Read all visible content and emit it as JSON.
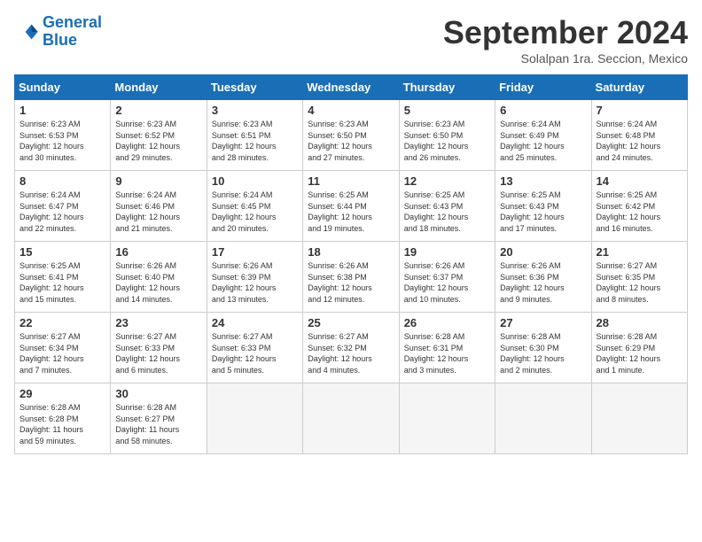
{
  "header": {
    "logo_line1": "General",
    "logo_line2": "Blue",
    "month": "September 2024",
    "location": "Solalpan 1ra. Seccion, Mexico"
  },
  "days_of_week": [
    "Sunday",
    "Monday",
    "Tuesday",
    "Wednesday",
    "Thursday",
    "Friday",
    "Saturday"
  ],
  "weeks": [
    [
      {
        "num": "1",
        "detail": "Sunrise: 6:23 AM\nSunset: 6:53 PM\nDaylight: 12 hours\nand 30 minutes."
      },
      {
        "num": "2",
        "detail": "Sunrise: 6:23 AM\nSunset: 6:52 PM\nDaylight: 12 hours\nand 29 minutes."
      },
      {
        "num": "3",
        "detail": "Sunrise: 6:23 AM\nSunset: 6:51 PM\nDaylight: 12 hours\nand 28 minutes."
      },
      {
        "num": "4",
        "detail": "Sunrise: 6:23 AM\nSunset: 6:50 PM\nDaylight: 12 hours\nand 27 minutes."
      },
      {
        "num": "5",
        "detail": "Sunrise: 6:23 AM\nSunset: 6:50 PM\nDaylight: 12 hours\nand 26 minutes."
      },
      {
        "num": "6",
        "detail": "Sunrise: 6:24 AM\nSunset: 6:49 PM\nDaylight: 12 hours\nand 25 minutes."
      },
      {
        "num": "7",
        "detail": "Sunrise: 6:24 AM\nSunset: 6:48 PM\nDaylight: 12 hours\nand 24 minutes."
      }
    ],
    [
      {
        "num": "8",
        "detail": "Sunrise: 6:24 AM\nSunset: 6:47 PM\nDaylight: 12 hours\nand 22 minutes."
      },
      {
        "num": "9",
        "detail": "Sunrise: 6:24 AM\nSunset: 6:46 PM\nDaylight: 12 hours\nand 21 minutes."
      },
      {
        "num": "10",
        "detail": "Sunrise: 6:24 AM\nSunset: 6:45 PM\nDaylight: 12 hours\nand 20 minutes."
      },
      {
        "num": "11",
        "detail": "Sunrise: 6:25 AM\nSunset: 6:44 PM\nDaylight: 12 hours\nand 19 minutes."
      },
      {
        "num": "12",
        "detail": "Sunrise: 6:25 AM\nSunset: 6:43 PM\nDaylight: 12 hours\nand 18 minutes."
      },
      {
        "num": "13",
        "detail": "Sunrise: 6:25 AM\nSunset: 6:43 PM\nDaylight: 12 hours\nand 17 minutes."
      },
      {
        "num": "14",
        "detail": "Sunrise: 6:25 AM\nSunset: 6:42 PM\nDaylight: 12 hours\nand 16 minutes."
      }
    ],
    [
      {
        "num": "15",
        "detail": "Sunrise: 6:25 AM\nSunset: 6:41 PM\nDaylight: 12 hours\nand 15 minutes."
      },
      {
        "num": "16",
        "detail": "Sunrise: 6:26 AM\nSunset: 6:40 PM\nDaylight: 12 hours\nand 14 minutes."
      },
      {
        "num": "17",
        "detail": "Sunrise: 6:26 AM\nSunset: 6:39 PM\nDaylight: 12 hours\nand 13 minutes."
      },
      {
        "num": "18",
        "detail": "Sunrise: 6:26 AM\nSunset: 6:38 PM\nDaylight: 12 hours\nand 12 minutes."
      },
      {
        "num": "19",
        "detail": "Sunrise: 6:26 AM\nSunset: 6:37 PM\nDaylight: 12 hours\nand 10 minutes."
      },
      {
        "num": "20",
        "detail": "Sunrise: 6:26 AM\nSunset: 6:36 PM\nDaylight: 12 hours\nand 9 minutes."
      },
      {
        "num": "21",
        "detail": "Sunrise: 6:27 AM\nSunset: 6:35 PM\nDaylight: 12 hours\nand 8 minutes."
      }
    ],
    [
      {
        "num": "22",
        "detail": "Sunrise: 6:27 AM\nSunset: 6:34 PM\nDaylight: 12 hours\nand 7 minutes."
      },
      {
        "num": "23",
        "detail": "Sunrise: 6:27 AM\nSunset: 6:33 PM\nDaylight: 12 hours\nand 6 minutes."
      },
      {
        "num": "24",
        "detail": "Sunrise: 6:27 AM\nSunset: 6:33 PM\nDaylight: 12 hours\nand 5 minutes."
      },
      {
        "num": "25",
        "detail": "Sunrise: 6:27 AM\nSunset: 6:32 PM\nDaylight: 12 hours\nand 4 minutes."
      },
      {
        "num": "26",
        "detail": "Sunrise: 6:28 AM\nSunset: 6:31 PM\nDaylight: 12 hours\nand 3 minutes."
      },
      {
        "num": "27",
        "detail": "Sunrise: 6:28 AM\nSunset: 6:30 PM\nDaylight: 12 hours\nand 2 minutes."
      },
      {
        "num": "28",
        "detail": "Sunrise: 6:28 AM\nSunset: 6:29 PM\nDaylight: 12 hours\nand 1 minute."
      }
    ],
    [
      {
        "num": "29",
        "detail": "Sunrise: 6:28 AM\nSunset: 6:28 PM\nDaylight: 11 hours\nand 59 minutes."
      },
      {
        "num": "30",
        "detail": "Sunrise: 6:28 AM\nSunset: 6:27 PM\nDaylight: 11 hours\nand 58 minutes."
      },
      {
        "num": "",
        "detail": ""
      },
      {
        "num": "",
        "detail": ""
      },
      {
        "num": "",
        "detail": ""
      },
      {
        "num": "",
        "detail": ""
      },
      {
        "num": "",
        "detail": ""
      }
    ]
  ]
}
